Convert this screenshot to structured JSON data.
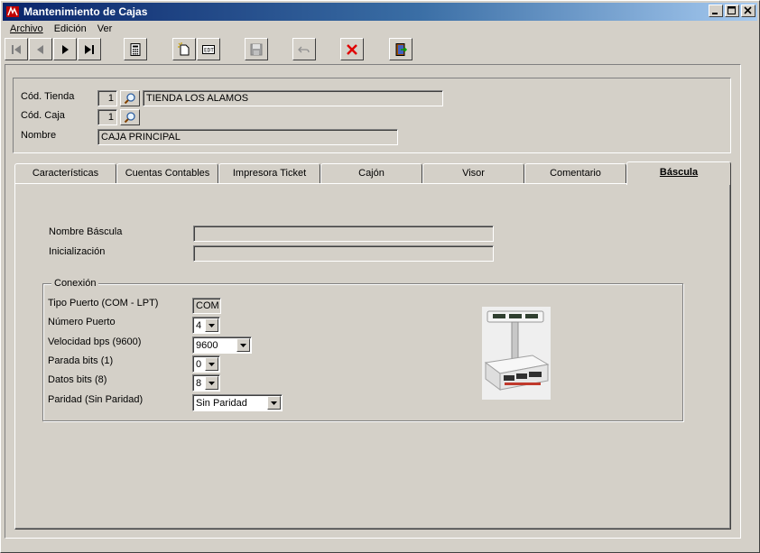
{
  "window": {
    "title": "Mantenimiento de Cajas"
  },
  "menu": {
    "items": [
      {
        "label": "Archivo"
      },
      {
        "label": "Edición"
      },
      {
        "label": "Ver"
      }
    ]
  },
  "toolbar": {
    "icons": [
      "first-record-icon",
      "previous-record-icon",
      "next-record-icon",
      "last-record-icon",
      "calculator-icon",
      "new-record-icon",
      "edit-record-icon",
      "save-icon",
      "undo-icon",
      "delete-icon",
      "exit-icon"
    ]
  },
  "header": {
    "tienda_label": "Cód. Tienda",
    "tienda_code": "1",
    "tienda_name": "TIENDA LOS ALAMOS",
    "caja_label": "Cód. Caja",
    "caja_code": "1",
    "nombre_label": "Nombre",
    "nombre_value": "CAJA PRINCIPAL"
  },
  "tabs": [
    {
      "label": "Características"
    },
    {
      "label": "Cuentas Contables"
    },
    {
      "label": "Impresora Ticket"
    },
    {
      "label": "Cajón"
    },
    {
      "label": "Visor"
    },
    {
      "label": "Comentario"
    },
    {
      "label": "Báscula"
    }
  ],
  "active_tab": "Báscula",
  "bascula": {
    "nombre_label": "Nombre Báscula",
    "nombre_value": "",
    "inicializacion_label": "Inicialización",
    "inicializacion_value": "",
    "conexion_legend": "Conexión",
    "tipo_puerto_label": "Tipo Puerto (COM - LPT)",
    "tipo_puerto_value": "COM",
    "numero_puerto_label": "Número Puerto",
    "numero_puerto_value": "4",
    "velocidad_label": "Velocidad bps (9600)",
    "velocidad_value": "9600",
    "parada_label": "Parada bits (1)",
    "parada_value": "0",
    "datos_label": "Datos bits (8)",
    "datos_value": "8",
    "paridad_label": "Paridad (Sin Paridad)",
    "paridad_value": "Sin Paridad"
  }
}
